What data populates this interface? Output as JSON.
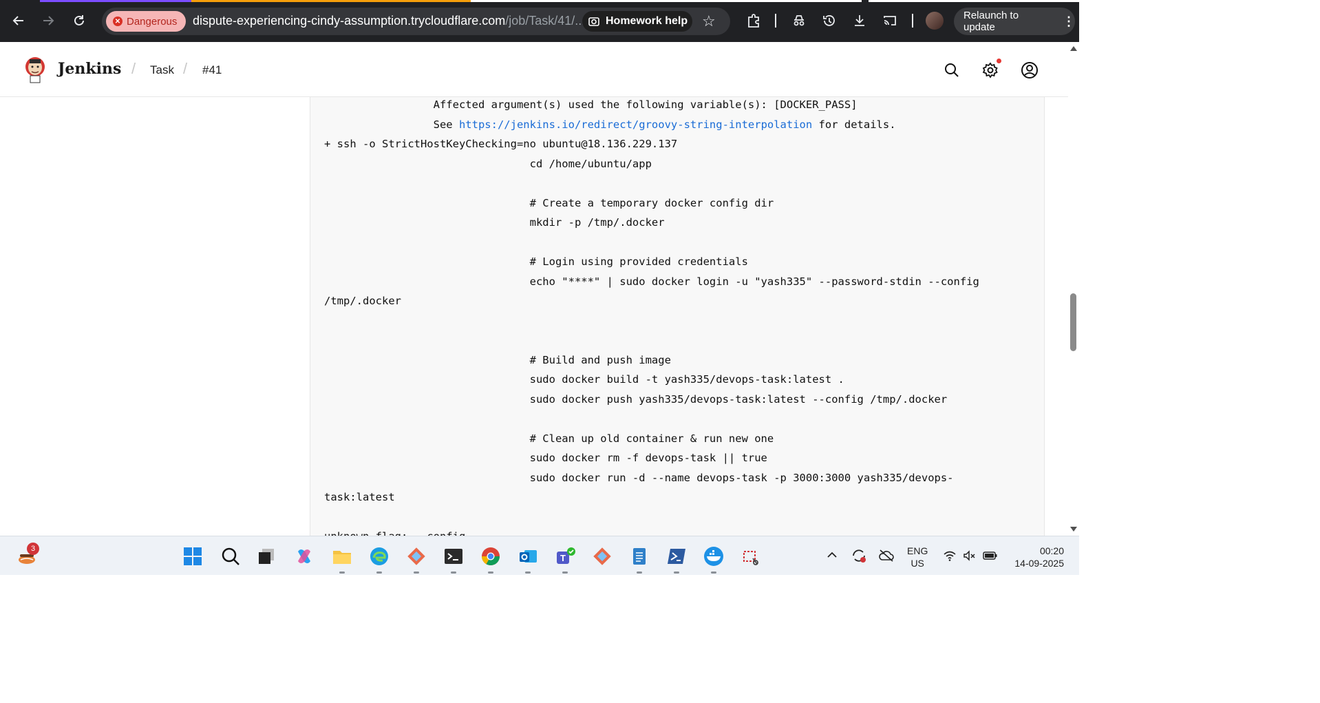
{
  "browser": {
    "back_icon": "arrow-left-icon",
    "forward_icon": "arrow-right-icon",
    "reload_icon": "reload-icon",
    "security_chip": "Dangerous",
    "url_host": "dispute-experiencing-cindy-assumption.trycloudflare.com",
    "url_path": "/job/Task/41/...",
    "homework_chip": "Homework help",
    "relaunch_label": "Relaunch to update",
    "tab_accent_colors": [
      "#7c4dff",
      "#f59e0b",
      "#ffffff"
    ]
  },
  "jenkins": {
    "title": "Jenkins",
    "breadcrumbs": [
      "Task",
      "#41"
    ]
  },
  "console": {
    "lines": [
      "                 Affected argument(s) used the following variable(s): [DOCKER_PASS]",
      "                 See ",
      "+ ssh -o StrictHostKeyChecking=no ubuntu@18.136.229.137",
      "                                cd /home/ubuntu/app",
      "",
      "                                # Create a temporary docker config dir",
      "                                mkdir -p /tmp/.docker",
      "",
      "                                # Login using provided credentials",
      "                                echo \"****\" | sudo docker login -u \"yash335\" --password-stdin --config",
      "/tmp/.docker",
      "",
      "",
      "                                # Build and push image",
      "                                sudo docker build -t yash335/devops-task:latest .",
      "                                sudo docker push yash335/devops-task:latest --config /tmp/.docker",
      "",
      "                                # Clean up old container & run new one",
      "                                sudo docker rm -f devops-task || true",
      "                                sudo docker run -d --name devops-task -p 3000:3000 yash335/devops-",
      "task:latest",
      "",
      "unknown flag: --config"
    ],
    "link_text": "https://jenkins.io/redirect/groovy-string-interpolation",
    "link_suffix": " for details."
  },
  "taskbar": {
    "notification_count": "3",
    "lang_line1": "ENG",
    "lang_line2": "US",
    "time": "00:20",
    "date": "14-09-2025"
  }
}
